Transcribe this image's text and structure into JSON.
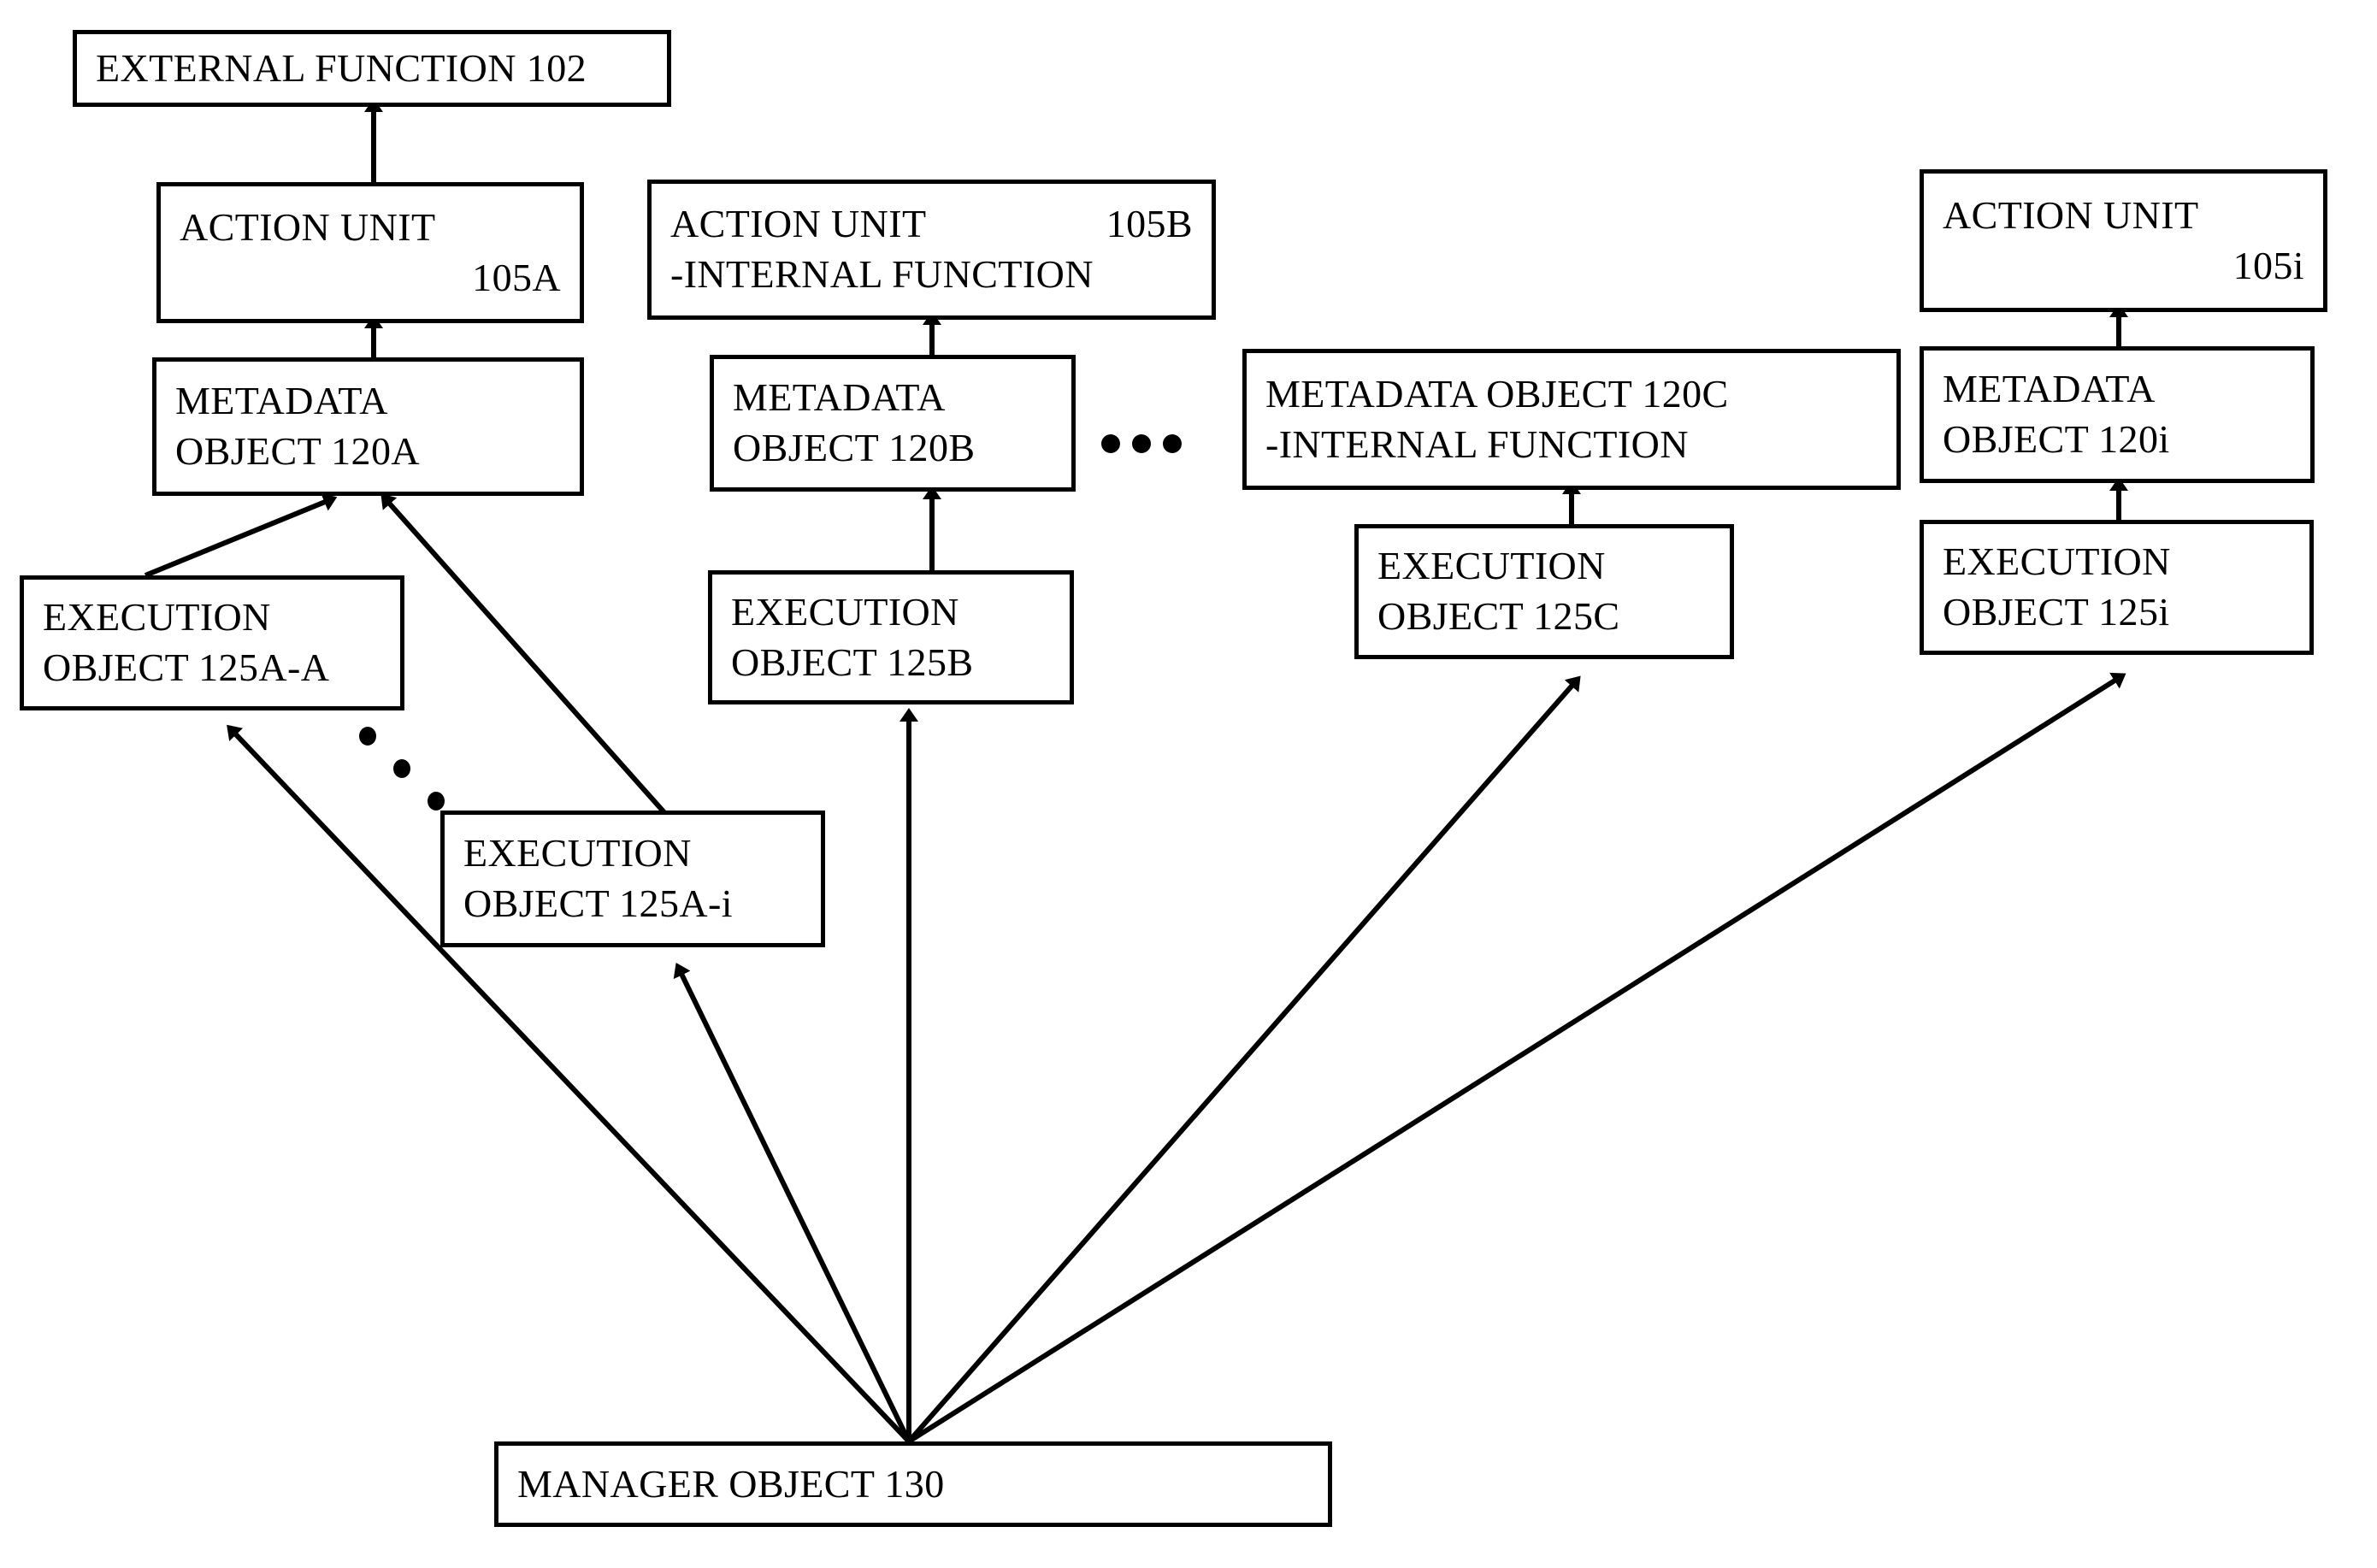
{
  "figure": {
    "title": "Object hierarchy block diagram",
    "stroke_color": "#000000",
    "background_color": "#ffffff"
  },
  "nodes": {
    "external_function": {
      "label": "EXTERNAL FUNCTION 102"
    },
    "action_unit_a": {
      "label": "ACTION UNIT",
      "ref": "105A"
    },
    "action_unit_b": {
      "label": "ACTION UNIT",
      "ref": "105B",
      "subtitle": "-INTERNAL FUNCTION"
    },
    "action_unit_i": {
      "label": "ACTION UNIT",
      "ref": "105i"
    },
    "metadata_a": {
      "line1": "METADATA",
      "line2": "OBJECT 120A"
    },
    "metadata_b": {
      "line1": "METADATA",
      "line2": "OBJECT 120B"
    },
    "metadata_c": {
      "line1": "METADATA OBJECT 120C",
      "line2": "-INTERNAL FUNCTION"
    },
    "metadata_i": {
      "line1": "METADATA",
      "line2": "OBJECT 120i"
    },
    "execution_aa": {
      "line1": "EXECUTION",
      "line2": "OBJECT 125A-A"
    },
    "execution_ai": {
      "line1": "EXECUTION",
      "line2": "OBJECT 125A-i"
    },
    "execution_b": {
      "line1": "EXECUTION",
      "line2": "OBJECT 125B"
    },
    "execution_c": {
      "line1": "EXECUTION",
      "line2": "OBJECT 125C"
    },
    "execution_i": {
      "line1": "EXECUTION",
      "line2": "OBJECT 125i"
    },
    "manager": {
      "label": "MANAGER OBJECT 130"
    }
  },
  "ellipses": {
    "horizontal_between_metadata": "•••",
    "diagonal_between_execution_a": "•••"
  }
}
